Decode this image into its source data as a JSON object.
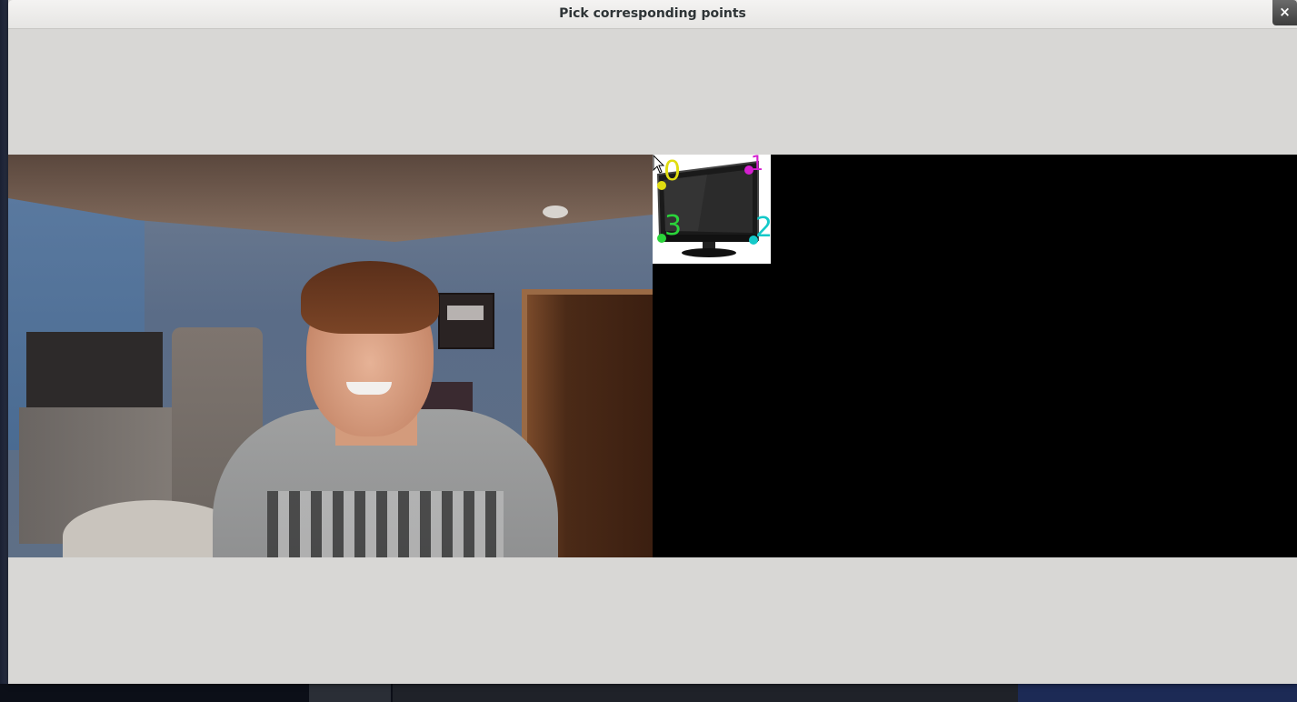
{
  "window": {
    "title": "Pick corresponding points",
    "close_symbol": "×"
  },
  "colors": {
    "window_bg": "#d8d7d5",
    "titlebar": "#eceae8",
    "canvas_bg": "#000000"
  },
  "target_points": [
    {
      "label": "0",
      "color": "#e0dc10",
      "icon": "point-marker"
    },
    {
      "label": "1",
      "color": "#d51fd0",
      "icon": "point-marker"
    },
    {
      "label": "2",
      "color": "#14c9c9",
      "icon": "point-marker"
    },
    {
      "label": "3",
      "color": "#2ad43a",
      "icon": "point-marker"
    }
  ],
  "icons": {
    "close": "close-icon",
    "cursor": "mouse-pointer-icon",
    "target_image": "television-icon"
  }
}
